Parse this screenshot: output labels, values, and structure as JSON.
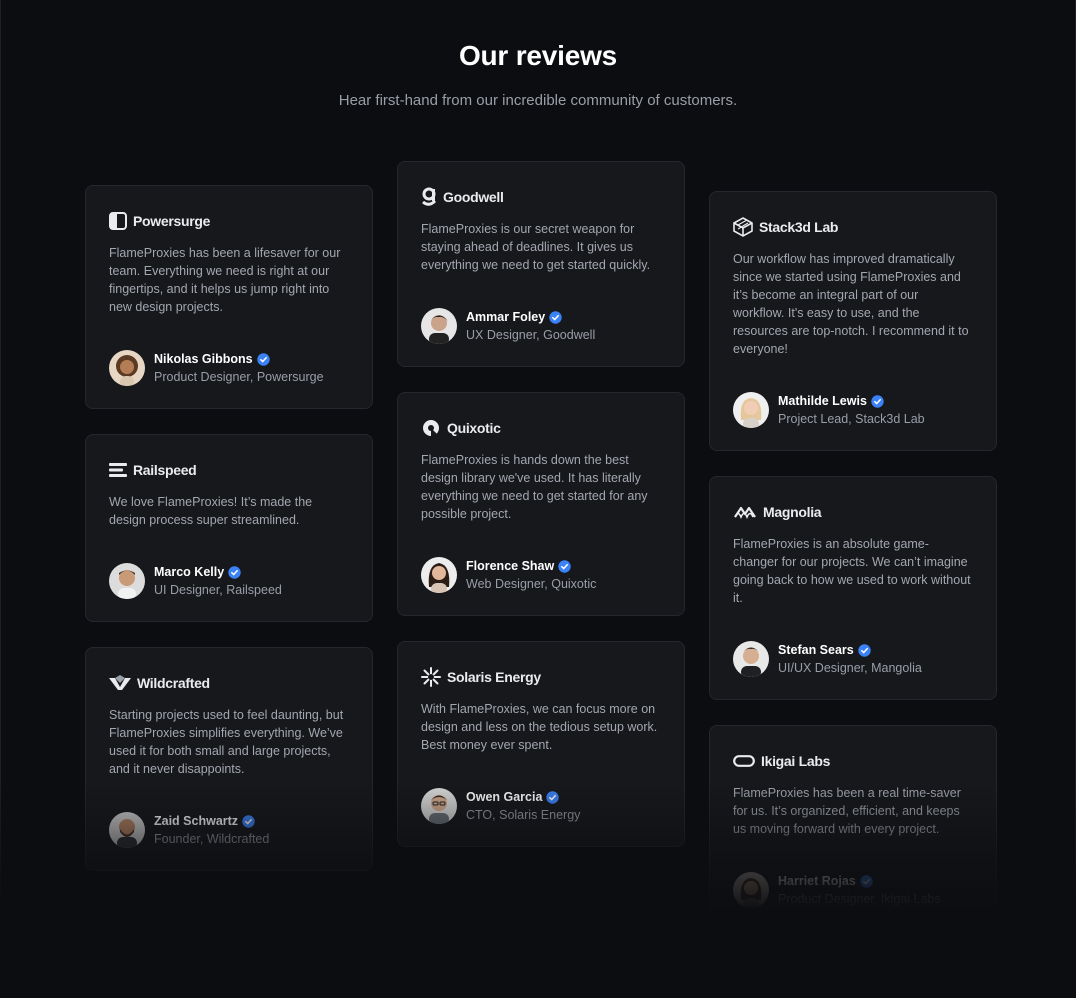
{
  "header": {
    "title": "Our reviews",
    "subtitle": "Hear first-hand from our incredible community of customers."
  },
  "colors": {
    "background": "#0c0d10",
    "card": "#16181c",
    "card_border": "#24272d",
    "verified": "#3b82f6"
  },
  "reviews": [
    {
      "brand": "Powersurge",
      "brand_icon": "powersurge-logo-icon",
      "quote": "FlameProxies has been a lifesaver for our team. Everything we need is right at our fingertips, and it helps us jump right into new design projects.",
      "name": "Nikolas Gibbons",
      "role": "Product Designer, Powersurge"
    },
    {
      "brand": "Railspeed",
      "brand_icon": "railspeed-logo-icon",
      "quote": "We love FlameProxies! It’s made the design process super streamlined.",
      "name": "Marco Kelly",
      "role": "UI Designer, Railspeed"
    },
    {
      "brand": "Wildcrafted",
      "brand_icon": "wildcrafted-logo-icon",
      "quote": "Starting projects used to feel daunting, but FlameProxies simplifies everything. We’ve used it for both small and large projects, and it never disappoints.",
      "name": "Zaid Schwartz",
      "role": "Founder, Wildcrafted"
    },
    {
      "brand": "Goodwell",
      "brand_icon": "goodwell-logo-icon",
      "quote": "FlameProxies is our secret weapon for staying ahead of deadlines. It gives us everything we need to get started quickly.",
      "name": "Ammar Foley",
      "role": "UX Designer, Goodwell"
    },
    {
      "brand": "Quixotic",
      "brand_icon": "quixotic-logo-icon",
      "quote": "FlameProxies is hands down the best design library we've used. It has literally everything we need to get started for any possible project.",
      "name": "Florence Shaw",
      "role": "Web Designer, Quixotic"
    },
    {
      "brand": "Solaris Energy",
      "brand_icon": "solaris-energy-logo-icon",
      "quote": "With FlameProxies, we can focus more on design and less on the tedious setup work. Best money ever spent.",
      "name": "Owen Garcia",
      "role": "CTO, Solaris Energy"
    },
    {
      "brand": "Stack3d Lab",
      "brand_icon": "stack3d-lab-logo-icon",
      "quote": "Our workflow has improved dramatically since we started using FlameProxies and it’s become an integral part of our workflow. It's easy to use, and the resources are top-notch. I recommend it to everyone!",
      "name": "Mathilde Lewis",
      "role": "Project Lead, Stack3d Lab"
    },
    {
      "brand": "Magnolia",
      "brand_icon": "magnolia-logo-icon",
      "quote": "FlameProxies is an absolute game-changer for our projects. We can’t imagine going back to how we used to work without it.",
      "name": "Stefan Sears",
      "role": "UI/UX Designer, Mangolia"
    },
    {
      "brand": "Ikigai Labs",
      "brand_icon": "ikigai-labs-logo-icon",
      "quote": "FlameProxies has been a real time-saver for us. It’s organized, efficient, and keeps us moving forward with every project.",
      "name": "Harriet Rojas",
      "role": "Product Designer, Ikigai Labs"
    }
  ]
}
